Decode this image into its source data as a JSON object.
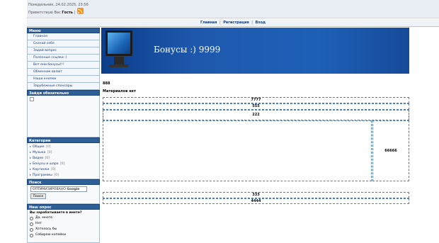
{
  "header": {
    "date": "Понедельник, 24.02.2025, 23:56",
    "greeting_prefix": "Приветствую Вас",
    "greeting_user": "Гость",
    "rss_icon": "rss-icon"
  },
  "nav": {
    "items": [
      "Главная",
      "Регистрация",
      "Вход"
    ],
    "separator": "|"
  },
  "sidebar": {
    "menu_title": "Меню",
    "menu_items": [
      "Главная",
      "Скачай себе",
      "Задай вопрос",
      "Полезные ссылки :)",
      "Вот они бонусы!!!",
      "Обменник валют",
      "Наши кнопки",
      "Зарубежные спонсоры"
    ],
    "ad_title": "Зайди обязательно",
    "categories_title": "Категории",
    "categories": [
      {
        "label": "Общие",
        "count": "[0]"
      },
      {
        "label": "Музыка",
        "count": "[0]"
      },
      {
        "label": "Видео",
        "count": "[0]"
      },
      {
        "label": "Бонусы и шара",
        "count": "[0]"
      },
      {
        "label": "Картинки",
        "count": "[0]"
      },
      {
        "label": "Программы",
        "count": "[0]"
      }
    ],
    "search_title": "Поиск",
    "search_placeholder": "ОПТИМИЗИРОВАНО",
    "search_brand": "Google",
    "search_button": "Поиск",
    "poll_title": "Наш опрос",
    "poll_question": "Вы зарабатываете в инете?",
    "poll_options": [
      "Да, много",
      "Нет",
      "Хотелось бы",
      "Собираю копейки"
    ]
  },
  "banner": {
    "title": "Бонусы :) 9999"
  },
  "content": {
    "line1": "888",
    "line2": "Материалов нет",
    "row1": "7777",
    "row2": "555",
    "row3": "222",
    "side_value": "66666",
    "row4": "333",
    "row5": "4444"
  }
}
